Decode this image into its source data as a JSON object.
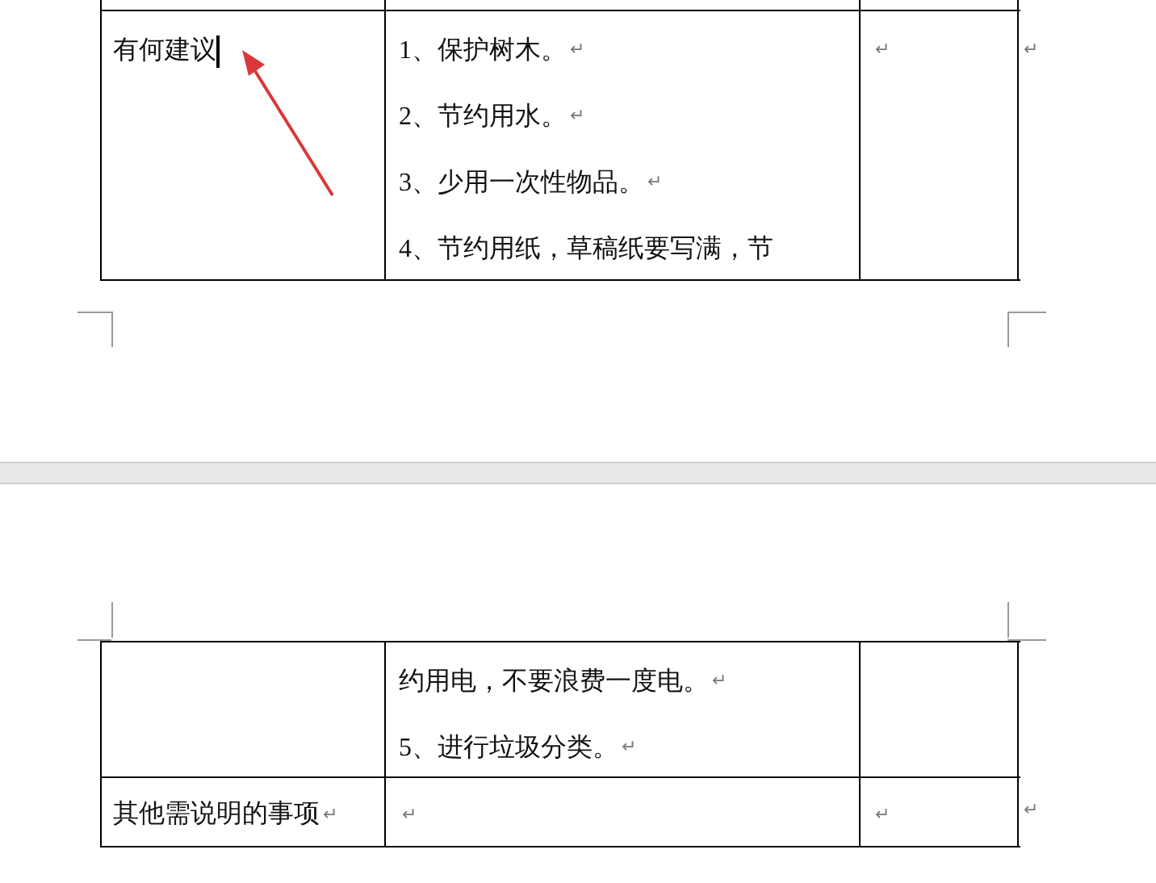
{
  "para_mark": "↵",
  "pages": [
    {
      "rows": [
        {
          "kind": "cut",
          "cells": [
            {},
            {},
            {}
          ],
          "row_end": false
        },
        {
          "kind": "full",
          "cells": [
            {
              "paragraphs": [
                {
                  "text": "有何建议",
                  "cursor": true
                }
              ]
            },
            {
              "paragraphs": [
                {
                  "text": "1、保护树木。",
                  "mark": true
                },
                {
                  "text": "2、节约用水。",
                  "mark": true
                },
                {
                  "text": "3、少用一次性物品。",
                  "mark": true
                },
                {
                  "text": "4、节约用纸，草稿纸要写满，节",
                  "mark": false
                }
              ]
            },
            {
              "paragraphs": [
                {
                  "mark": true
                }
              ]
            }
          ],
          "row_end": true
        }
      ]
    },
    {
      "rows": [
        {
          "kind": "full",
          "cells": [
            {},
            {
              "paragraphs": [
                {
                  "text": "约用电，不要浪费一度电。",
                  "mark": true
                },
                {
                  "text": "5、进行垃圾分类。",
                  "mark": true
                }
              ]
            },
            {}
          ],
          "row_end": false
        },
        {
          "kind": "short",
          "cells": [
            {
              "paragraphs": [
                {
                  "text": "其他需说明的事项",
                  "mark": true
                }
              ]
            },
            {
              "paragraphs": [
                {
                  "mark": true
                }
              ]
            },
            {
              "paragraphs": [
                {
                  "mark": true
                }
              ]
            }
          ],
          "row_end": true
        }
      ]
    }
  ],
  "annotation": {
    "kind": "arrow"
  }
}
